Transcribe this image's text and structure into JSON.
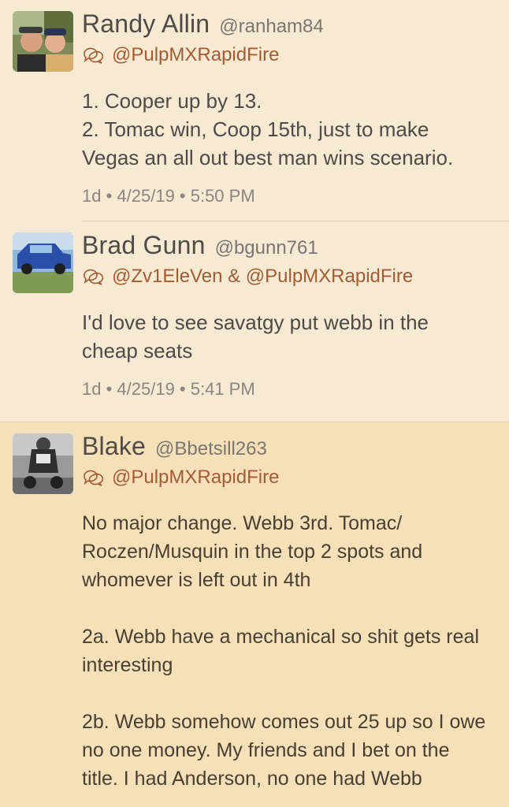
{
  "tweets": [
    {
      "name": "Randy Allin",
      "handle": "@ranham84",
      "reply_to": "@PulpMXRapidFire",
      "text": "1. Cooper up by 13.\n2. Tomac win, Coop 15th, just to make Vegas an all out best man wins scenario.",
      "timestamp": "1d • 4/25/19 • 5:50 PM"
    },
    {
      "name": "Brad Gunn",
      "handle": "@bgunn761",
      "reply_to": "@Zv1EleVen & @PulpMXRapidFire",
      "text": "I'd love to see savatgy put webb in the cheap seats",
      "timestamp": "1d • 4/25/19 • 5:41 PM"
    },
    {
      "name": "Blake",
      "handle": "@Bbetsill263",
      "reply_to": "@PulpMXRapidFire",
      "text": "No major change. Webb 3rd. Tomac/ Roczen/Musquin in the top 2 spots and whomever is left out in 4th\n\n2a. Webb have a mechanical so shit gets real interesting\n\n2b. Webb somehow comes out 25 up so I owe no one money. My friends and I bet on the title. I had Anderson, no one had Webb"
    }
  ],
  "colors": {
    "background": "#f6ead3",
    "highlighted_background": "#f5e0ba",
    "reply_accent": "#a25b34",
    "text": "#4f4a45",
    "secondary_text": "#8b857d"
  },
  "icons": {
    "reply": "conversation-bubbles-icon"
  }
}
